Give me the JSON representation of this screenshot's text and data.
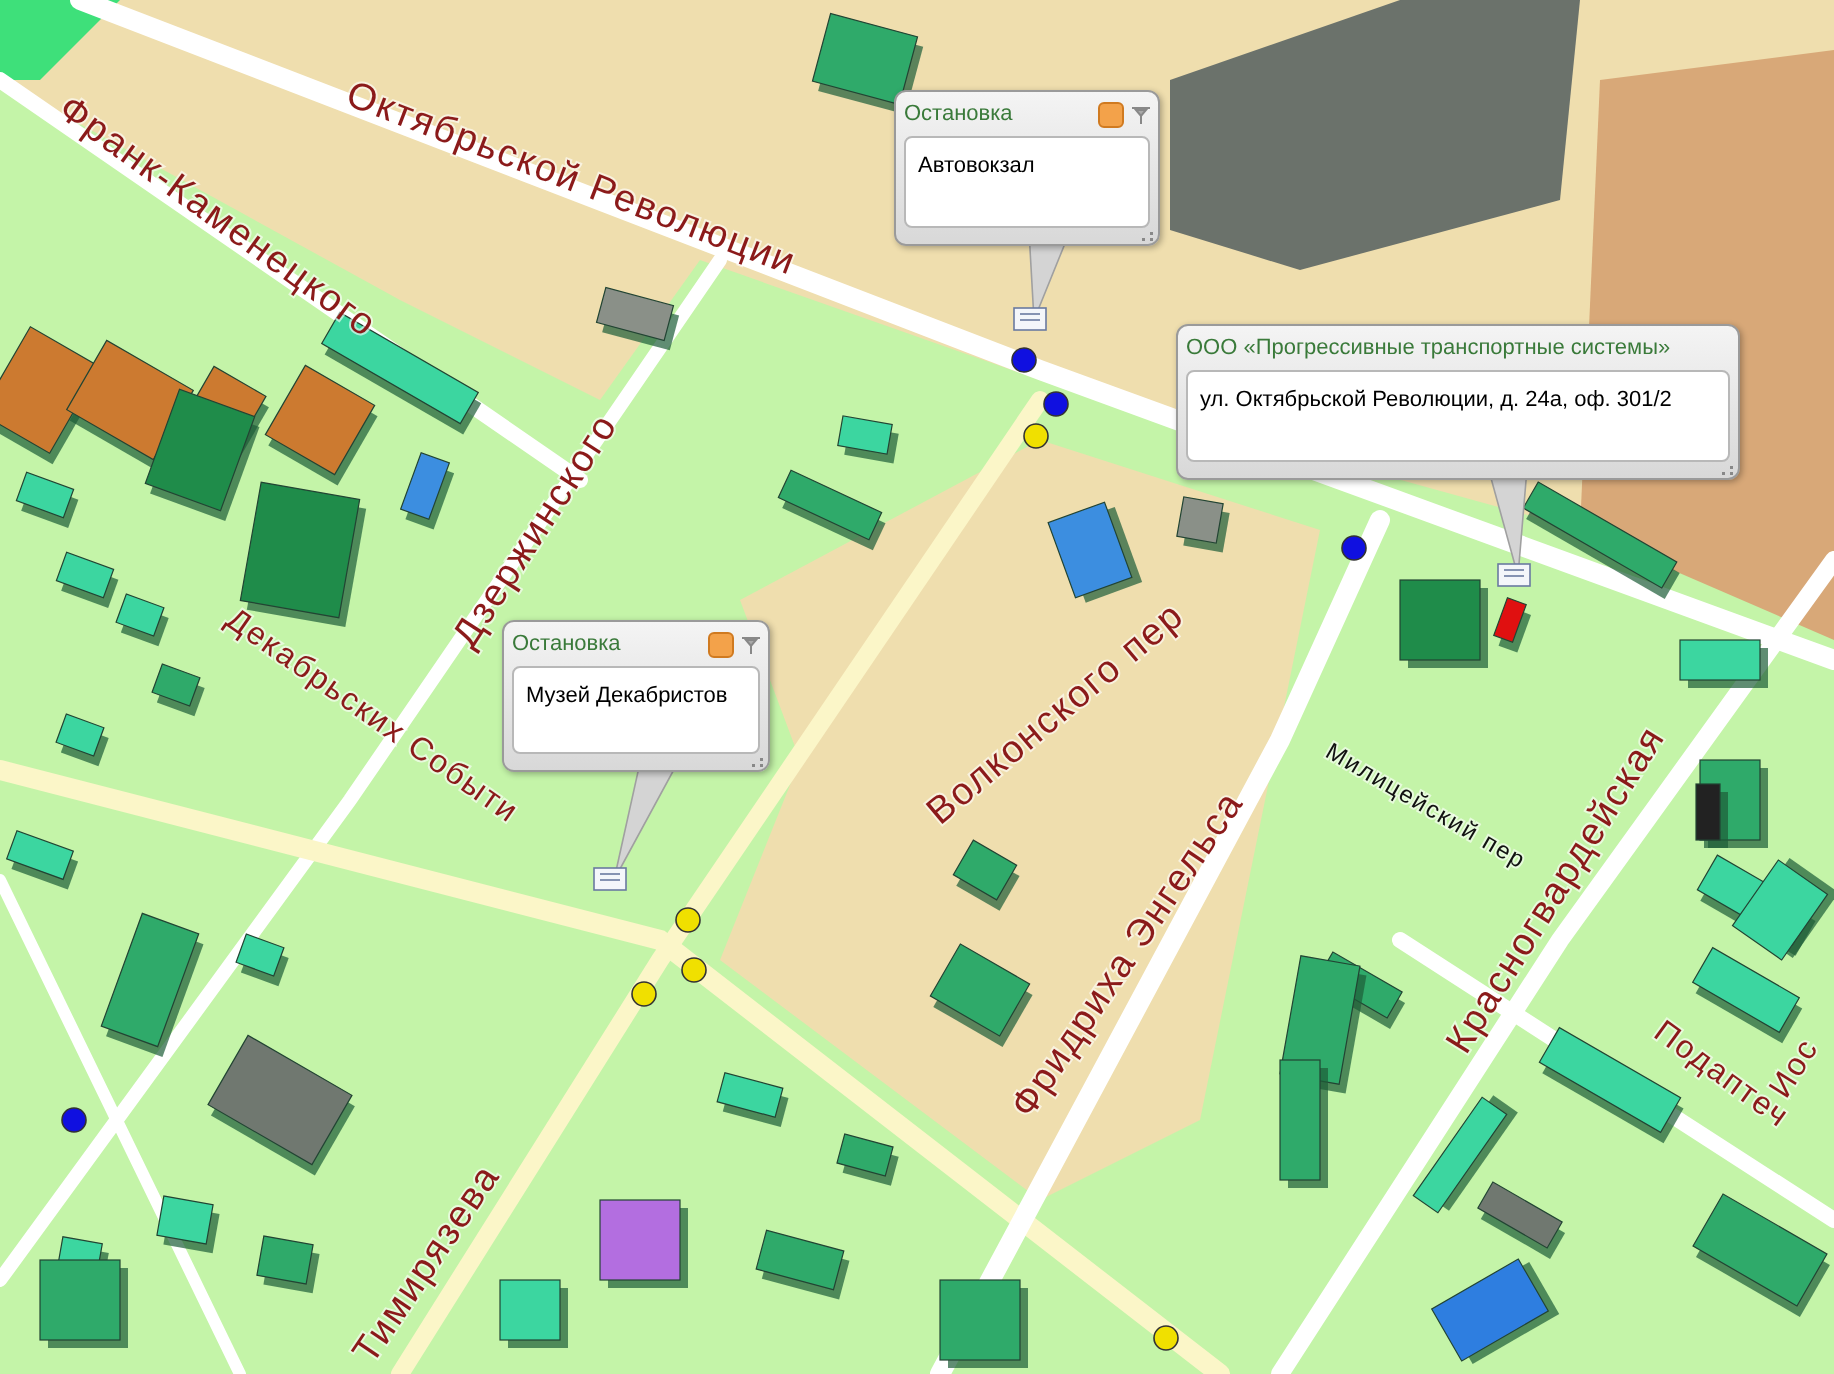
{
  "map": {
    "streets": [
      {
        "name": "Октябрьской Революции"
      },
      {
        "name": "Франк-Каменецкого"
      },
      {
        "name": "Дзержинского"
      },
      {
        "name": "Декабрьских Событи"
      },
      {
        "name": "Волконского пер"
      },
      {
        "name": "Фридриха Энгельса"
      },
      {
        "name": "Милицейский пер"
      },
      {
        "name": "Красногвардейская"
      },
      {
        "name": "Тимирязева"
      },
      {
        "name": "Подаптеч"
      },
      {
        "name": "Иос"
      }
    ],
    "stops": [
      {
        "color": "#1010e0"
      },
      {
        "color": "#1010e0"
      },
      {
        "color": "#1010e0"
      },
      {
        "color": "#1010e0"
      },
      {
        "color": "#f0e000"
      },
      {
        "color": "#f0e000"
      },
      {
        "color": "#f0e000"
      },
      {
        "color": "#f0e000"
      },
      {
        "color": "#f0e000"
      }
    ],
    "popups": [
      {
        "title": "Остановка",
        "text": "Автовокзал"
      },
      {
        "title": "ООО «Прогрессивные транспортные системы»",
        "text": "ул. Октябрьской Революции, д. 24а, оф. 301/2"
      },
      {
        "title": "Остановка",
        "text": "Музей Декабристов"
      }
    ]
  }
}
